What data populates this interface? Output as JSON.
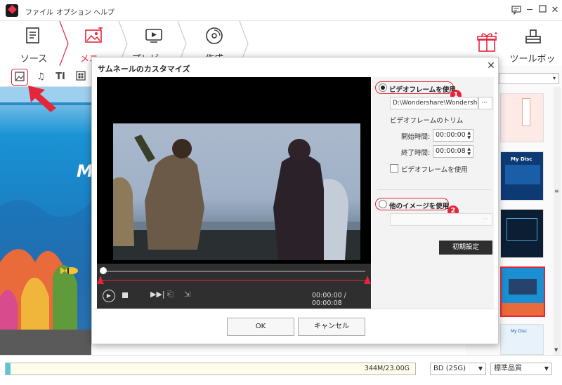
{
  "menu": {
    "file": "ファイル",
    "options": "オプション",
    "help": "ヘルプ"
  },
  "steps": [
    {
      "label": "ソース"
    },
    {
      "label": "メニュー"
    },
    {
      "label": "プレビュー"
    },
    {
      "label": "作成"
    }
  ],
  "toolbox": {
    "label": "ツールボックス"
  },
  "preview_text": "M",
  "dialog": {
    "title": "サムネールのカスタマイズ",
    "use_video_frame": "ビデオフレームを使用",
    "badge1": "1",
    "path": "D:\\Wondershare\\Wondershare",
    "browse": "···",
    "trim_label": "ビデオフレームのトリム",
    "start_label": "開始時間:",
    "start_value": "00:00:00",
    "end_label": "終了時間:",
    "end_value": "00:00:08",
    "check_label": "ビデオフレームを使用",
    "use_other_image": "他のイメージを使用",
    "badge2": "2",
    "browse2": "···",
    "reset": "初期設定",
    "time": "00:00:00 / 00:00:08",
    "ok": "OK",
    "cancel": "キャンセル"
  },
  "thumbs": {
    "mydisc": "My Disc"
  },
  "bottom": {
    "capacity": "344M/23.00G",
    "disc": "BD (25G)",
    "quality": "標準品質"
  },
  "colors": {
    "accent": "#e3263a",
    "capacity_fill": "#5cc6d6"
  }
}
